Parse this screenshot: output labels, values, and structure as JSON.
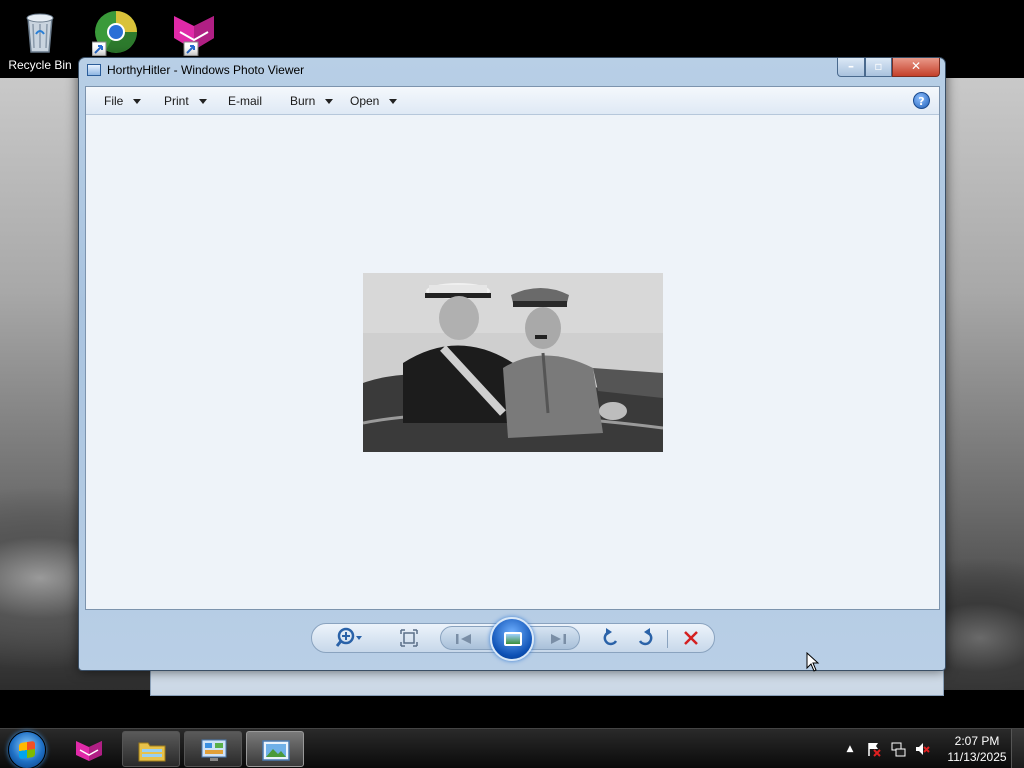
{
  "desktop": {
    "icons": [
      {
        "label": "Recycle Bin",
        "icon": "recycle-bin-icon"
      },
      {
        "label": "",
        "icon": "browser-icon"
      },
      {
        "label": "",
        "icon": "app-cube-icon"
      }
    ]
  },
  "window": {
    "title": "HorthyHitler - Windows Photo Viewer",
    "menu": [
      {
        "label": "File",
        "has_caret": true
      },
      {
        "label": "Print",
        "has_caret": true
      },
      {
        "label": "E-mail",
        "has_caret": false
      },
      {
        "label": "Burn",
        "has_caret": true
      },
      {
        "label": "Open",
        "has_caret": true
      }
    ],
    "help_label": "?",
    "controls": {
      "zoom": "zoom-icon",
      "actual_size": "fit-window-icon",
      "previous": "previous-icon",
      "slideshow": "slideshow-icon",
      "next": "next-icon",
      "rotate_ccw": "rotate-counterclockwise-icon",
      "rotate_cw": "rotate-clockwise-icon",
      "delete": "delete-icon"
    }
  },
  "taskbar": {
    "clock_time": "2:07 PM",
    "clock_date": "11/13/2025",
    "tray_up_arrow": "▲"
  },
  "colors": {
    "accent": "#2a62a8",
    "close_red": "#c4402a",
    "delete_red": "#d42020"
  }
}
